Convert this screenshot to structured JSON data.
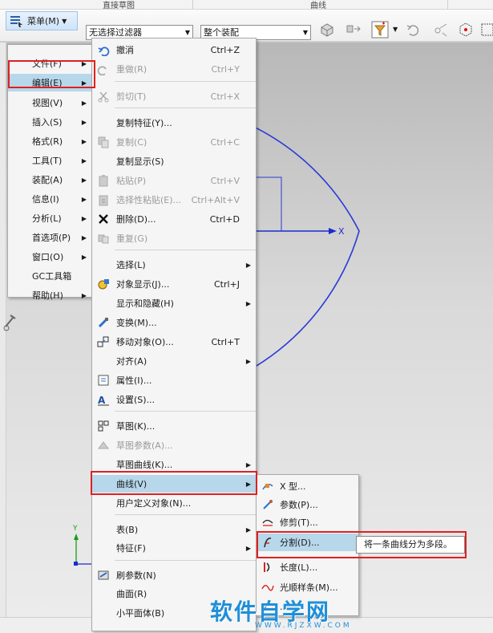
{
  "ribbon": {
    "group_left": "直接草图",
    "group_mid": "曲线"
  },
  "toolbar": {
    "menu_label": "菜单(M)",
    "filter_combo": "无选择过滤器",
    "assembly_combo": "整个装配"
  },
  "graphics": {
    "axis_x_label": "X",
    "axis_y_label": "Y"
  },
  "main_menu": {
    "items": [
      {
        "label": "文件(F)"
      },
      {
        "label": "编辑(E)"
      },
      {
        "label": "视图(V)"
      },
      {
        "label": "插入(S)"
      },
      {
        "label": "格式(R)"
      },
      {
        "label": "工具(T)"
      },
      {
        "label": "装配(A)"
      },
      {
        "label": "信息(I)"
      },
      {
        "label": "分析(L)"
      },
      {
        "label": "首选项(P)"
      },
      {
        "label": "窗口(O)"
      },
      {
        "label": "GC工具箱"
      },
      {
        "label": "帮助(H)"
      }
    ]
  },
  "edit_menu": {
    "items": [
      {
        "label": "撤消",
        "shortcut": "Ctrl+Z",
        "icon": "undo-icon"
      },
      {
        "label": "重做(R)",
        "shortcut": "Ctrl+Y",
        "icon": "redo-icon"
      },
      {
        "label": "剪切(T)",
        "shortcut": "Ctrl+X",
        "icon": "cut-icon"
      },
      {
        "label": "复制特征(Y)...",
        "shortcut": ""
      },
      {
        "label": "复制(C)",
        "shortcut": "Ctrl+C",
        "icon": "copy-icon"
      },
      {
        "label": "复制显示(S)",
        "shortcut": ""
      },
      {
        "label": "粘贴(P)",
        "shortcut": "Ctrl+V",
        "icon": "paste-icon"
      },
      {
        "label": "选择性粘贴(E)...",
        "shortcut": "Ctrl+Alt+V",
        "icon": "paste-special-icon"
      },
      {
        "label": "删除(D)...",
        "shortcut": "Ctrl+D",
        "icon": "delete-icon"
      },
      {
        "label": "重复(G)",
        "shortcut": "",
        "icon": "repeat-icon"
      },
      {
        "label": "选择(L)",
        "shortcut": ""
      },
      {
        "label": "对象显示(J)...",
        "shortcut": "Ctrl+J",
        "icon": "object-display-icon"
      },
      {
        "label": "显示和隐藏(H)",
        "shortcut": ""
      },
      {
        "label": "变换(M)...",
        "shortcut": "",
        "icon": "transform-icon"
      },
      {
        "label": "移动对象(O)...",
        "shortcut": "Ctrl+T",
        "icon": "move-object-icon"
      },
      {
        "label": "对齐(A)",
        "shortcut": ""
      },
      {
        "label": "属性(I)...",
        "shortcut": "",
        "icon": "properties-icon"
      },
      {
        "label": "设置(S)...",
        "shortcut": "",
        "icon": "settings-icon"
      },
      {
        "label": "草图(K)...",
        "shortcut": "",
        "icon": "sketch-icon"
      },
      {
        "label": "草图参数(A)...",
        "shortcut": "",
        "icon": "sketch-params-icon"
      },
      {
        "label": "草图曲线(K)...",
        "shortcut": ""
      },
      {
        "label": "曲线(V)",
        "shortcut": ""
      },
      {
        "label": "用户定义对象(N)...",
        "shortcut": ""
      },
      {
        "label": "表(B)",
        "shortcut": ""
      },
      {
        "label": "特征(F)",
        "shortcut": ""
      },
      {
        "label": "刷参数(N)",
        "shortcut": "",
        "icon": "brush-params-icon"
      },
      {
        "label": "曲面(R)",
        "shortcut": ""
      },
      {
        "label": "小平面体(B)",
        "shortcut": ""
      }
    ]
  },
  "curve_menu": {
    "items": [
      {
        "label": "X 型...",
        "icon": "x-form-icon"
      },
      {
        "label": "参数(P)...",
        "icon": "parameter-icon"
      },
      {
        "label": "修剪(T)...",
        "icon": "trim-icon"
      },
      {
        "label": "分割(D)...",
        "icon": "divide-curve-icon"
      },
      {
        "label": "长度(L)...",
        "icon": "length-icon"
      },
      {
        "label": "光顺样条(M)...",
        "icon": "smooth-spline-icon"
      },
      {
        "label": "...",
        "icon": "curve-extra-icon"
      }
    ]
  },
  "tooltip": {
    "text": "将一条曲线分为多段。"
  },
  "watermark": {
    "main": "软件自学网",
    "sub": "WWW.RJZXW.COM"
  }
}
